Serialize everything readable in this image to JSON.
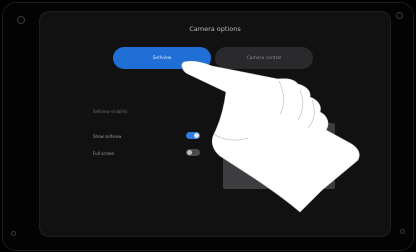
{
  "panel": {
    "title": "Camera options"
  },
  "tabs": [
    {
      "label": "Selfview",
      "active": true
    },
    {
      "label": "Camera control",
      "active": false
    }
  ],
  "selfview": {
    "section_label": "Selfview visibility",
    "rows": [
      {
        "label": "Show selfview",
        "on": true
      },
      {
        "label": "Full screen",
        "on": false
      }
    ]
  },
  "colors": {
    "accent": "#1f6fd6",
    "toggle_on": "#2f7be6",
    "background": "#111112"
  }
}
